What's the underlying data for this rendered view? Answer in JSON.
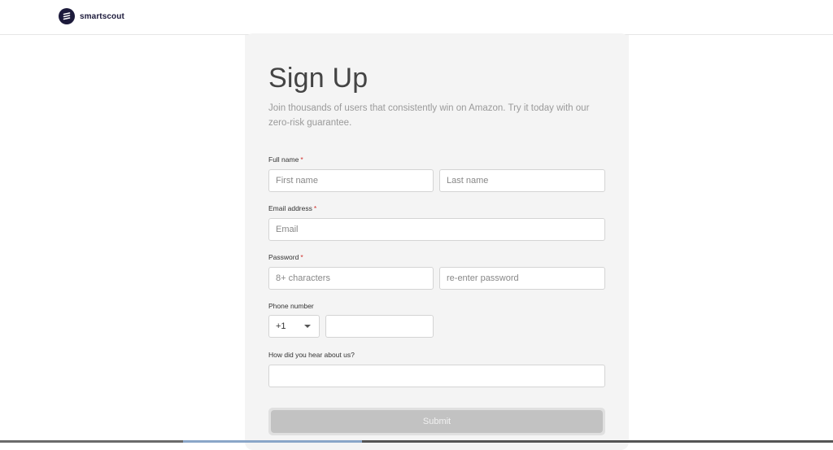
{
  "brand": {
    "name": "smartscout"
  },
  "form": {
    "title": "Sign Up",
    "subtitle": "Join thousands of users that consistently win on Amazon. Try it today with our zero-risk guarantee.",
    "full_name": {
      "label": "Full name",
      "required_mark": "*",
      "first_placeholder": "First name",
      "last_placeholder": "Last name"
    },
    "email": {
      "label": "Email address",
      "required_mark": "*",
      "placeholder": "Email"
    },
    "password": {
      "label": "Password",
      "required_mark": "*",
      "placeholder": "8+ characters",
      "confirm_placeholder": "re-enter password"
    },
    "phone": {
      "label": "Phone number",
      "country_code": "+1",
      "value": ""
    },
    "referral": {
      "label": "How did you hear about us?",
      "value": ""
    },
    "submit_label": "Submit"
  },
  "colors": {
    "brand": "#1c1a3b",
    "required": "#d0312d",
    "card_bg": "#f4f4f4",
    "submit_bg": "#c2c2c2"
  }
}
